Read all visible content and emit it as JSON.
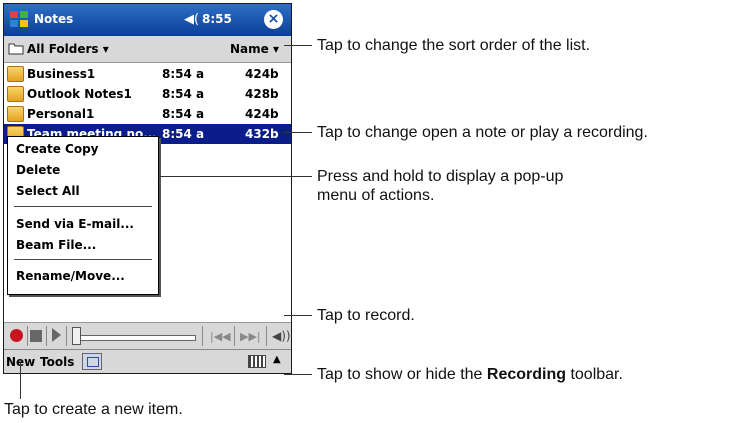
{
  "window": {
    "title": "Notes",
    "time": "8:55",
    "speaker_glyph": "◀(",
    "close_glyph": "×"
  },
  "folder_bar": {
    "folder": "All Folders",
    "sort": "Name"
  },
  "notes": [
    {
      "name": "Business1",
      "time": "8:54 a",
      "size": "424b"
    },
    {
      "name": "Outlook Notes1",
      "time": "8:54 a",
      "size": "428b"
    },
    {
      "name": "Personal1",
      "time": "8:54 a",
      "size": "424b"
    },
    {
      "name": "Team meeting no...",
      "time": "8:54 a",
      "size": "432b"
    }
  ],
  "popup_menu": {
    "items": [
      "Create Copy",
      "Delete",
      "Select All",
      "Send via E-mail...",
      "Beam File...",
      "Rename/Move..."
    ]
  },
  "menubar": {
    "new_label": "New",
    "tools_label": "Tools"
  },
  "callouts": {
    "sort": "Tap to change the sort order of the list.",
    "open": "Tap to change open a note or play a recording.",
    "popup_line1": "Press and hold to display a pop-up",
    "popup_line2": "menu of actions.",
    "record": "Tap to record.",
    "toolbar_prefix": "Tap to show or hide the ",
    "toolbar_bold": "Recording",
    "toolbar_suffix": " toolbar.",
    "new": "Tap to create a new item."
  },
  "colors": {
    "title_bar": "#0a3f98",
    "selection": "#0a1d8a",
    "record": "#c8141e"
  }
}
